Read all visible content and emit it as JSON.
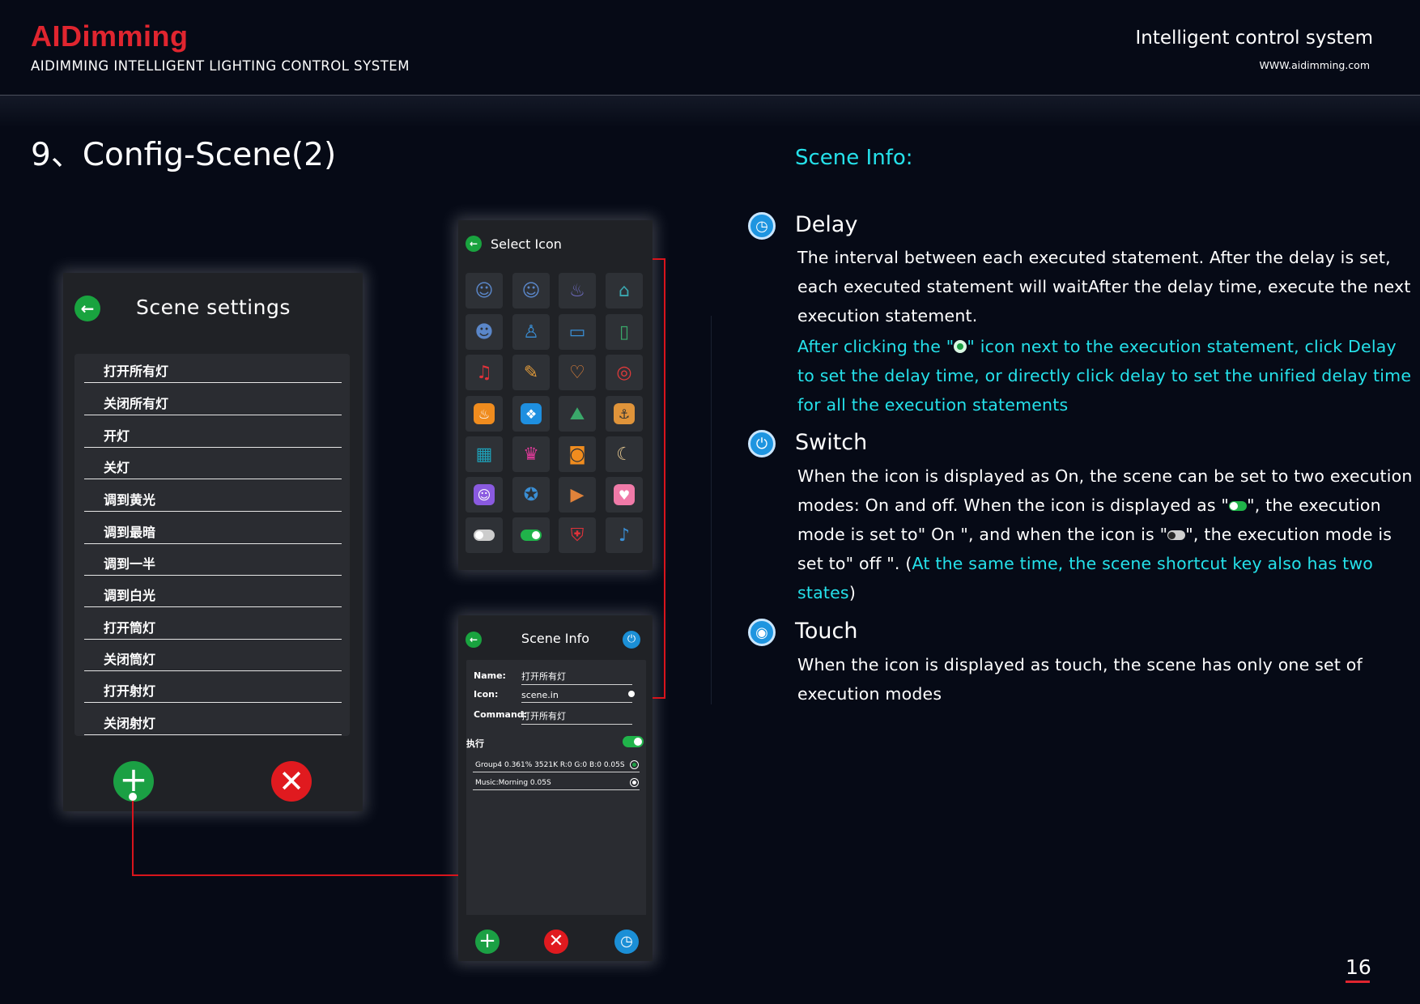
{
  "header": {
    "logo_text": "AIDimming",
    "subtitle": "AIDIMMING INTELLIGENT LIGHTING CONTROL SYSTEM",
    "right_title": "Intelligent control system",
    "url": "WWW.aidimming.com"
  },
  "page_title": "9、Config-Scene(2)",
  "scene_settings": {
    "title": "Scene settings",
    "back_icon": "arrow-left-icon",
    "items": [
      "打开所有灯",
      "关闭所有灯",
      "开灯",
      "关灯",
      "调到黄光",
      "调到最暗",
      "调到一半",
      "调到白光",
      "打开筒灯",
      "关闭筒灯",
      "打开射灯",
      "关闭射灯"
    ],
    "add_icon": "plus-icon",
    "delete_icon": "close-icon"
  },
  "select_icon": {
    "title": "Select Icon",
    "icons": [
      {
        "name": "person-arrive-icon",
        "glyph": "☺",
        "color": "#5a86c8"
      },
      {
        "name": "person-leave-icon",
        "glyph": "☺",
        "color": "#5a86c8"
      },
      {
        "name": "bed-sleep-icon",
        "glyph": "♨",
        "color": "#6e6cc0"
      },
      {
        "name": "bed-wake-icon",
        "glyph": "⌂",
        "color": "#3aa7b0"
      },
      {
        "name": "group-meeting-icon",
        "glyph": "☻",
        "color": "#5a86c8"
      },
      {
        "name": "family-icon",
        "glyph": "♙",
        "color": "#3a8fd6"
      },
      {
        "name": "tv-icon",
        "glyph": "▭",
        "color": "#3a8fd6"
      },
      {
        "name": "book-icon",
        "glyph": "▯",
        "color": "#3aa86a"
      },
      {
        "name": "music-icon",
        "glyph": "♫",
        "color": "#e0323a"
      },
      {
        "name": "microphone-icon",
        "glyph": "✎",
        "color": "#e09a3a"
      },
      {
        "name": "heart-hands-icon",
        "glyph": "♡",
        "color": "#e0823a"
      },
      {
        "name": "dining-icon",
        "glyph": "◎",
        "color": "#e03a3a"
      },
      {
        "name": "restaurant-icon",
        "glyph": "♨",
        "color": "#ffffff",
        "bg": "#f08c1e"
      },
      {
        "name": "pets-icon",
        "glyph": "❖",
        "color": "#ffffff",
        "bg": "#1e8fe0"
      },
      {
        "name": "landscape-icon",
        "glyph": "⛰",
        "color": "#3aa86a"
      },
      {
        "name": "ship-icon",
        "glyph": "⚓",
        "color": "#333333",
        "bg": "#e0943a"
      },
      {
        "name": "grid-settings-icon",
        "glyph": "▦",
        "color": "#1ea0b8"
      },
      {
        "name": "birthday-cake-icon",
        "glyph": "♛",
        "color": "#e03a9a"
      },
      {
        "name": "gift-icon",
        "glyph": "◙",
        "color": "#f08c1e"
      },
      {
        "name": "moon-icon",
        "glyph": "☾",
        "color": "#e6c890"
      },
      {
        "name": "robot-icon",
        "glyph": "☺",
        "color": "#ffffff",
        "bg": "#8a5ae0"
      },
      {
        "name": "film-reel-icon",
        "glyph": "✪",
        "color": "#3a8fd6"
      },
      {
        "name": "presentation-icon",
        "glyph": "▶",
        "color": "#e0823a"
      },
      {
        "name": "heart-icon",
        "glyph": "♥",
        "color": "#ffffff",
        "bg": "#f07aa8"
      },
      {
        "name": "toggle-off-icon",
        "glyph": "toggle-off",
        "color": "#cccccc"
      },
      {
        "name": "toggle-on-icon",
        "glyph": "toggle-on",
        "color": "#20b34a"
      },
      {
        "name": "security-shield-icon",
        "glyph": "⛨",
        "color": "#e0323a"
      },
      {
        "name": "bell-icon",
        "glyph": "♪",
        "color": "#3a8fd6"
      }
    ]
  },
  "scene_info": {
    "title": "Scene Info",
    "fields": [
      {
        "label": "Name:",
        "value": "打开所有灯"
      },
      {
        "label": "Icon:",
        "value": "scene.in"
      },
      {
        "label": "Command:",
        "value": "打开所有灯"
      }
    ],
    "exec_label": "执行",
    "statements": [
      "Group4 0.361% 3521K R:0 G:0 B:0  0.05S",
      "Music:Morning 0.05S"
    ]
  },
  "info": {
    "heading": "Scene Info:",
    "delay": {
      "title": "Delay",
      "text": "The interval between each executed statement. After the delay is set, each executed statement will waitAfter the delay time, execute the next execution statement.",
      "note_pre": "After clicking the \"",
      "note_post": "\" icon next to the execution statement, click Delay to set the delay time, or directly click delay to set the unified delay time for all the execution statements"
    },
    "switch": {
      "title": "Switch",
      "text_1": "When the icon is displayed as On, the scene can be set to two execution modes: On and off. When the icon is displayed as \"",
      "text_2": "\", the execution mode is set to\" On \", and when the icon is \"",
      "text_3": "\", the execution mode is set to\" off \". (",
      "text_cyan": "At the same time, the scene shortcut key also has two states",
      "text_4": ")"
    },
    "touch": {
      "title": "Touch",
      "text": "When the icon is displayed as touch, the scene has only one set of execution modes"
    }
  },
  "page_number": "16",
  "colors": {
    "accent_red": "#e0252f",
    "accent_cyan": "#25e1ea",
    "background": "#060a16"
  }
}
